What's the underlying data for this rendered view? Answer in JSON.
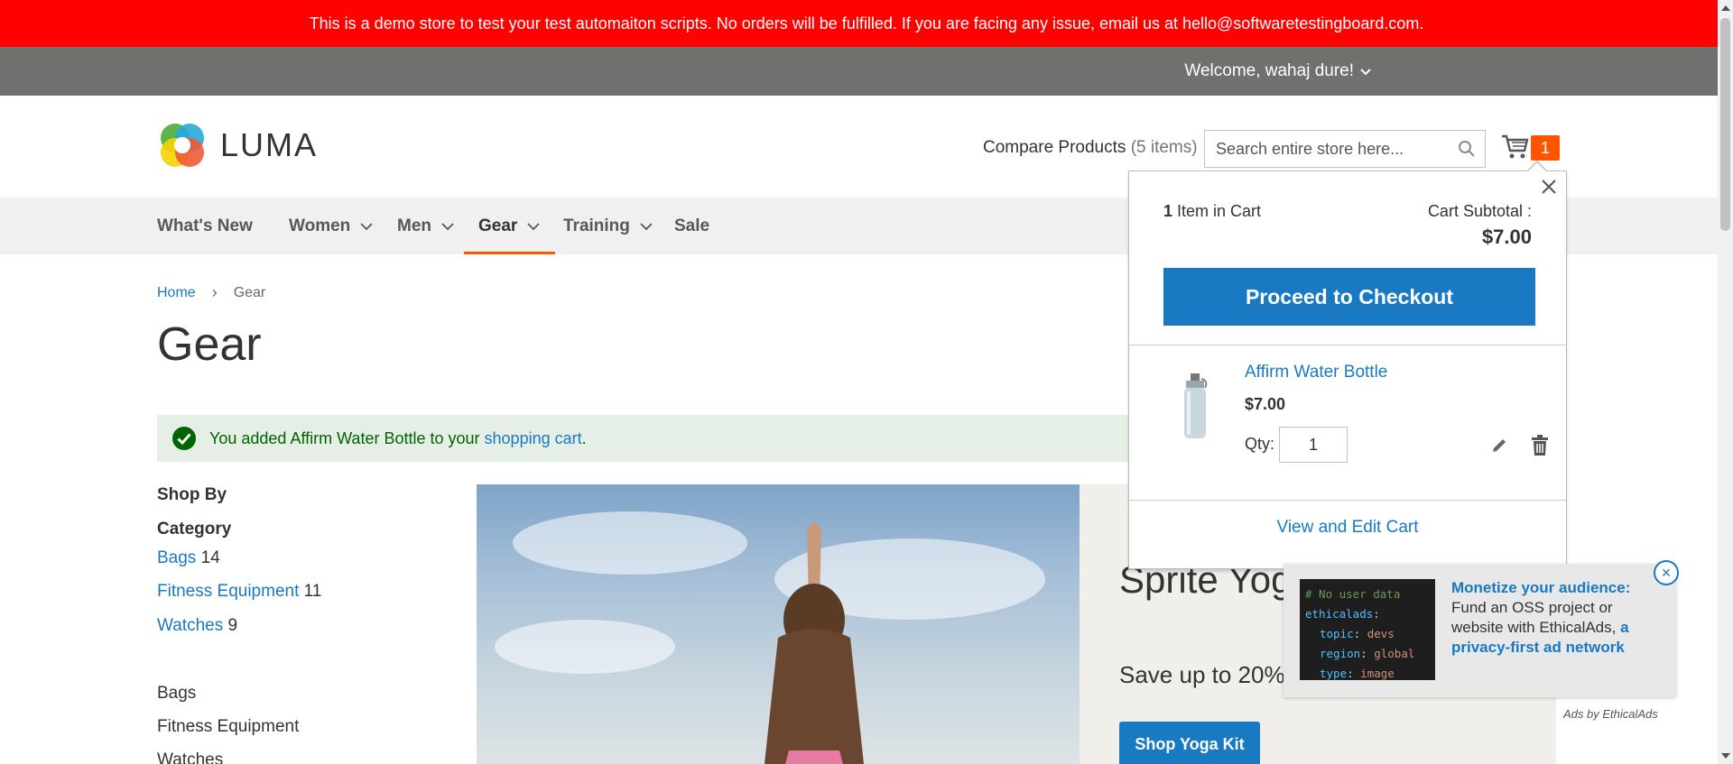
{
  "banner": {
    "text": "This is a demo store to test your test automaiton scripts. No orders will be fulfilled. If you are facing any issue, email us at hello@softwaretestingboard.com."
  },
  "header": {
    "welcome": "Welcome, wahaj dure!",
    "logo_text": "LUMA",
    "compare_label": "Compare Products",
    "compare_count": "(5 items)",
    "search_placeholder": "Search entire store here...",
    "cart_count": "1"
  },
  "nav": {
    "items": [
      {
        "label": "What's New",
        "has_dropdown": false
      },
      {
        "label": "Women",
        "has_dropdown": true
      },
      {
        "label": "Men",
        "has_dropdown": true
      },
      {
        "label": "Gear",
        "has_dropdown": true,
        "active": true
      },
      {
        "label": "Training",
        "has_dropdown": true
      },
      {
        "label": "Sale",
        "has_dropdown": false
      }
    ]
  },
  "breadcrumb": {
    "home": "Home",
    "separator": "›",
    "current": "Gear"
  },
  "page_title": "Gear",
  "message": {
    "prefix": "You added Affirm Water Bottle to your",
    "link": "shopping cart",
    "suffix": "."
  },
  "sidebar": {
    "shop_by": "Shop By",
    "category_title": "Category",
    "filters": [
      {
        "label": "Bags",
        "count": "14"
      },
      {
        "label": "Fitness Equipment",
        "count": "11"
      },
      {
        "label": "Watches",
        "count": "9"
      }
    ],
    "categories": [
      "Bags",
      "Fitness Equipment",
      "Watches"
    ]
  },
  "hero": {
    "title": "Sprite Yoga Companion",
    "subtitle": "Save up to 20%",
    "button": "Shop Yoga Kit"
  },
  "minicart": {
    "count_num": "1",
    "count_label": "Item in Cart",
    "subtotal_label": "Cart Subtotal :",
    "subtotal": "$7.00",
    "checkout_label": "Proceed to Checkout",
    "item": {
      "name": "Affirm Water Bottle",
      "price": "$7.00",
      "qty_label": "Qty:",
      "qty": "1"
    },
    "view_edit": "View and Edit Cart"
  },
  "ad": {
    "code_lines": [
      {
        "text": "# No user data"
      },
      {
        "key": "ethicalads",
        "value": ""
      },
      {
        "key": "topic",
        "value": "devs"
      },
      {
        "key": "region",
        "value": "global"
      },
      {
        "key": "type",
        "value": "image"
      }
    ],
    "headline": "Monetize your audience:",
    "body": "Fund an OSS project or website with EthicalAds,",
    "link": "a privacy-first ad network",
    "close": "×",
    "by": "Ads by EthicalAds"
  },
  "colors": {
    "banner": "#ff0101",
    "accent": "#ff5501",
    "link": "#1979c3",
    "panel": "#6e716e"
  }
}
